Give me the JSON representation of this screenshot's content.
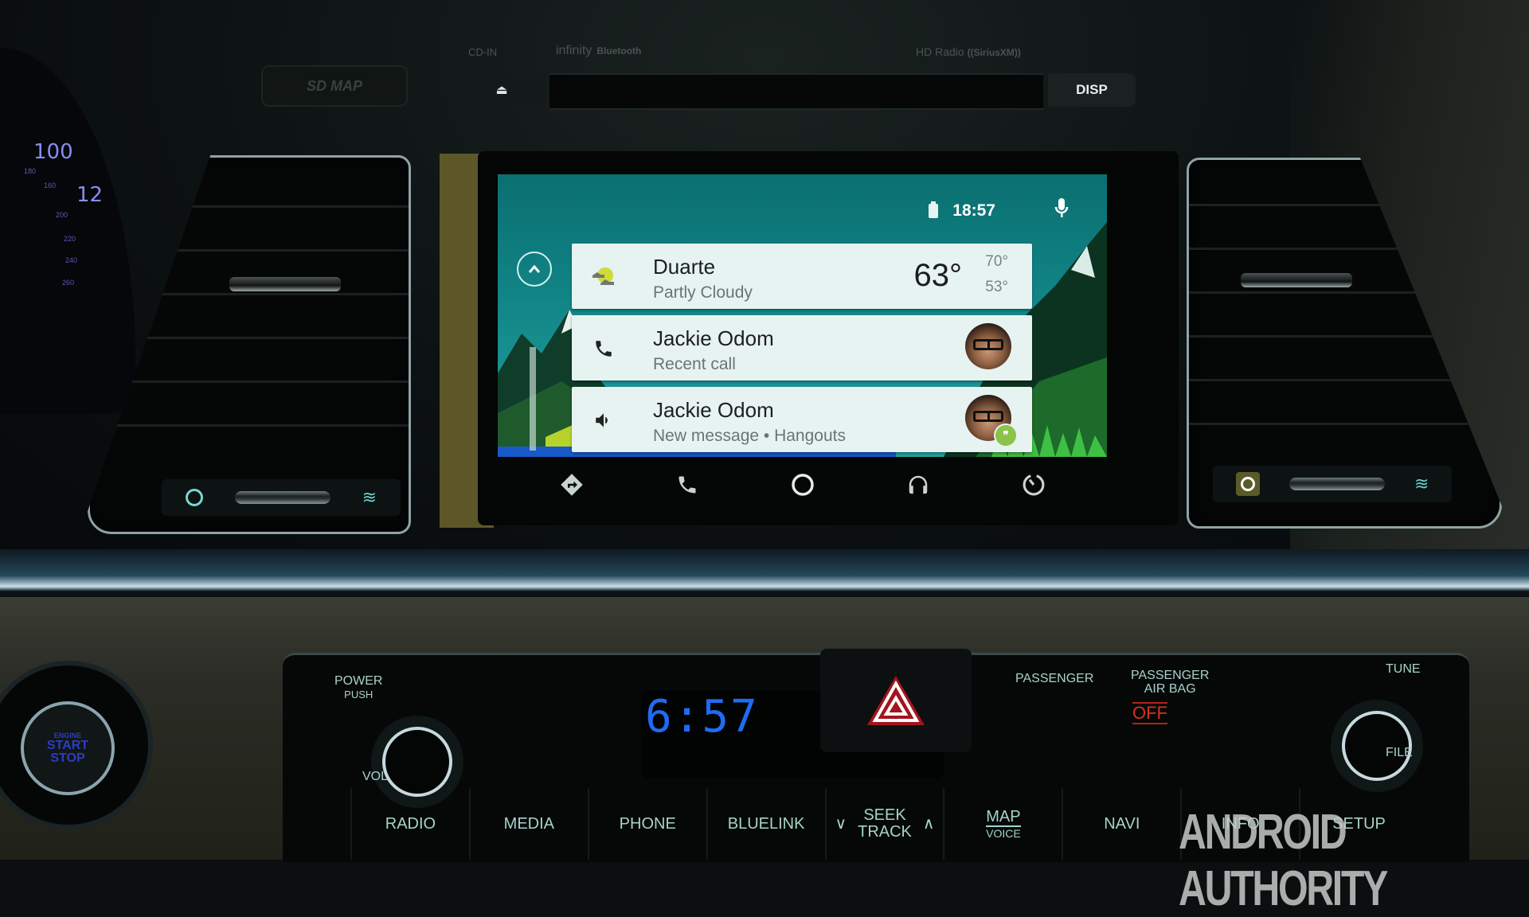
{
  "head_unit": {
    "sd_map_label": "SD MAP",
    "cd_in_label": "CD-IN",
    "brand_label": "infinity",
    "bluetooth_label": "Bluetooth",
    "hd_radio_label": "HD Radio",
    "siriusxm_label": "((SiriusXM))",
    "eject_symbol": "⏏",
    "disp_label": "DISP"
  },
  "instrument_cluster": {
    "speed_primary": "100",
    "speed_secondary": "12",
    "minor_ticks": [
      "180",
      "160",
      "200",
      "220",
      "240",
      "260"
    ]
  },
  "android_auto": {
    "status_bar": {
      "time": "18:57",
      "battery_icon": "battery-charging-icon",
      "mic_icon": "microphone-icon"
    },
    "up_button_icon": "chevron-up-icon",
    "cards": [
      {
        "type": "weather",
        "icon": "partly-cloudy-icon",
        "title": "Duarte",
        "subtitle": "Partly Cloudy",
        "temp_current": "63°",
        "temp_high": "70°",
        "temp_low": "53°"
      },
      {
        "type": "call",
        "icon": "phone-icon",
        "title": "Jackie Odom",
        "subtitle": "Recent call",
        "avatar": "contact-avatar"
      },
      {
        "type": "message",
        "icon": "speaker-icon",
        "title": "Jackie Odom",
        "subtitle": "New message • Hangouts",
        "avatar": "contact-avatar",
        "badge": "hangouts-icon",
        "badge_glyph": "❞"
      }
    ],
    "nav_bar": [
      {
        "name": "navigation",
        "icon": "directions-icon"
      },
      {
        "name": "phone",
        "icon": "phone-icon"
      },
      {
        "name": "home",
        "icon": "home-circle-icon"
      },
      {
        "name": "music",
        "icon": "headphones-icon"
      },
      {
        "name": "car",
        "icon": "speedometer-exit-icon"
      }
    ]
  },
  "console": {
    "start_button": {
      "line1": "ENGINE",
      "line2": "START",
      "line3": "STOP"
    },
    "power_label": "POWER",
    "push_label": "PUSH",
    "vol_label": "VOL",
    "clock_display": "6:57",
    "passenger_label": "PASSENGER",
    "airbag_label_1": "PASSENGER",
    "airbag_label_2": "AIR BAG",
    "airbag_status": "OFF",
    "tune_label": "TUNE",
    "file_label": "FILE",
    "buttons": [
      {
        "label": "RADIO"
      },
      {
        "label": "MEDIA"
      },
      {
        "label": "PHONE"
      },
      {
        "label": "BLUELINK"
      },
      {
        "label": "SEEK",
        "label2": "TRACK",
        "down": "∨",
        "up": "∧"
      },
      {
        "label": "MAP",
        "label2": "VOICE"
      },
      {
        "label": "NAVI"
      },
      {
        "label": "INFO"
      },
      {
        "label": "SETUP"
      }
    ]
  },
  "watermark": "ANDROID AUTHORITY",
  "colors": {
    "screen_teal": "#118587",
    "card_bg": "#e6f3f1",
    "clock_blue": "#1e6cf2",
    "airbag_red": "#d7321c",
    "hangouts_green": "#8bc34a",
    "button_label": "#a6d3c8"
  }
}
